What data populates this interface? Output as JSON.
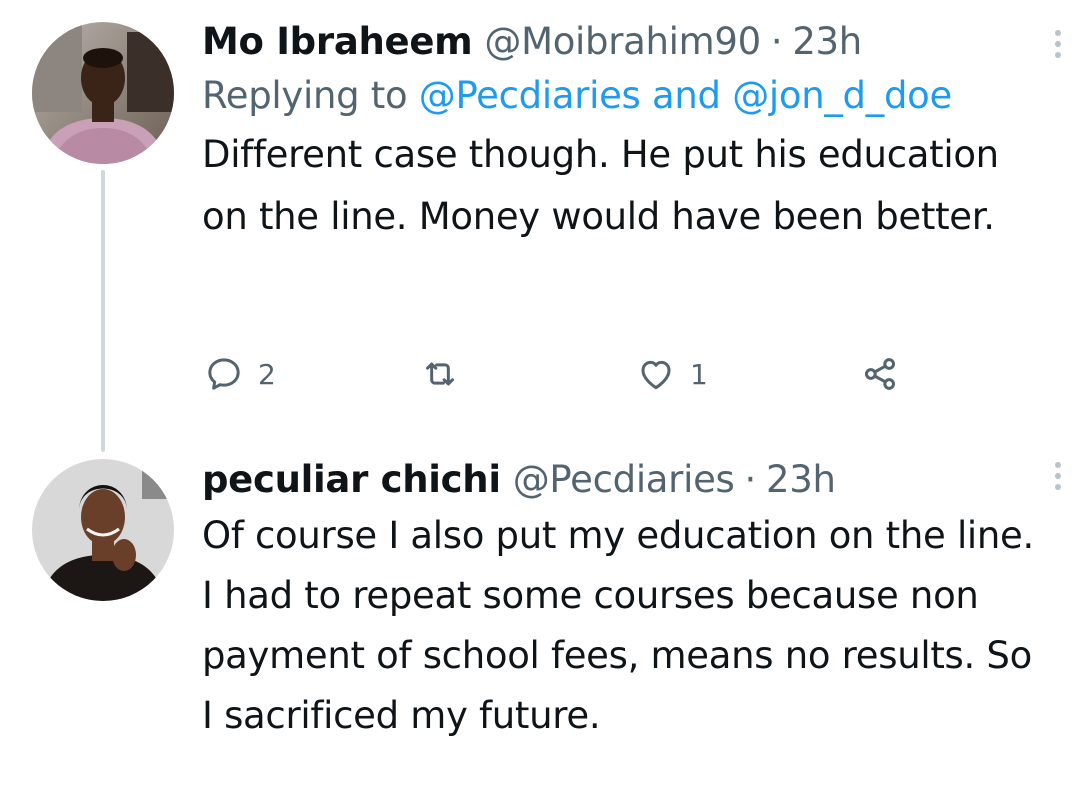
{
  "tweets": [
    {
      "name": "Mo Ibraheem",
      "handle": "@Moibrahim90",
      "separator": "·",
      "time": "23h",
      "reply": {
        "prefix": "Replying to ",
        "mention1": "@Pecdiaries",
        "conjunction": " and ",
        "mention2": "@jon_d_doe"
      },
      "text": "Different case though. He put his education on the line. Money would have been better.",
      "actions": {
        "reply_icon": "comment-icon",
        "replies": "2",
        "retweet_icon": "retweet-icon",
        "retweets": "",
        "like_icon": "heart-icon",
        "likes": "1",
        "share_icon": "share-icon"
      },
      "avatar_icon": "user-photo-avatar"
    },
    {
      "name": "peculiar chichi",
      "handle": "@Pecdiaries",
      "separator": "·",
      "time": "23h",
      "text": "Of course I also put my education on the line. I had to repeat some courses because non payment of school fees, means no results. So I sacrificed my future.",
      "avatar_icon": "user-photo-avatar"
    }
  ],
  "colors": {
    "text_primary": "#0f1419",
    "text_secondary": "#536471",
    "link": "#1d9bf0",
    "thread_line": "#cfd9de"
  }
}
